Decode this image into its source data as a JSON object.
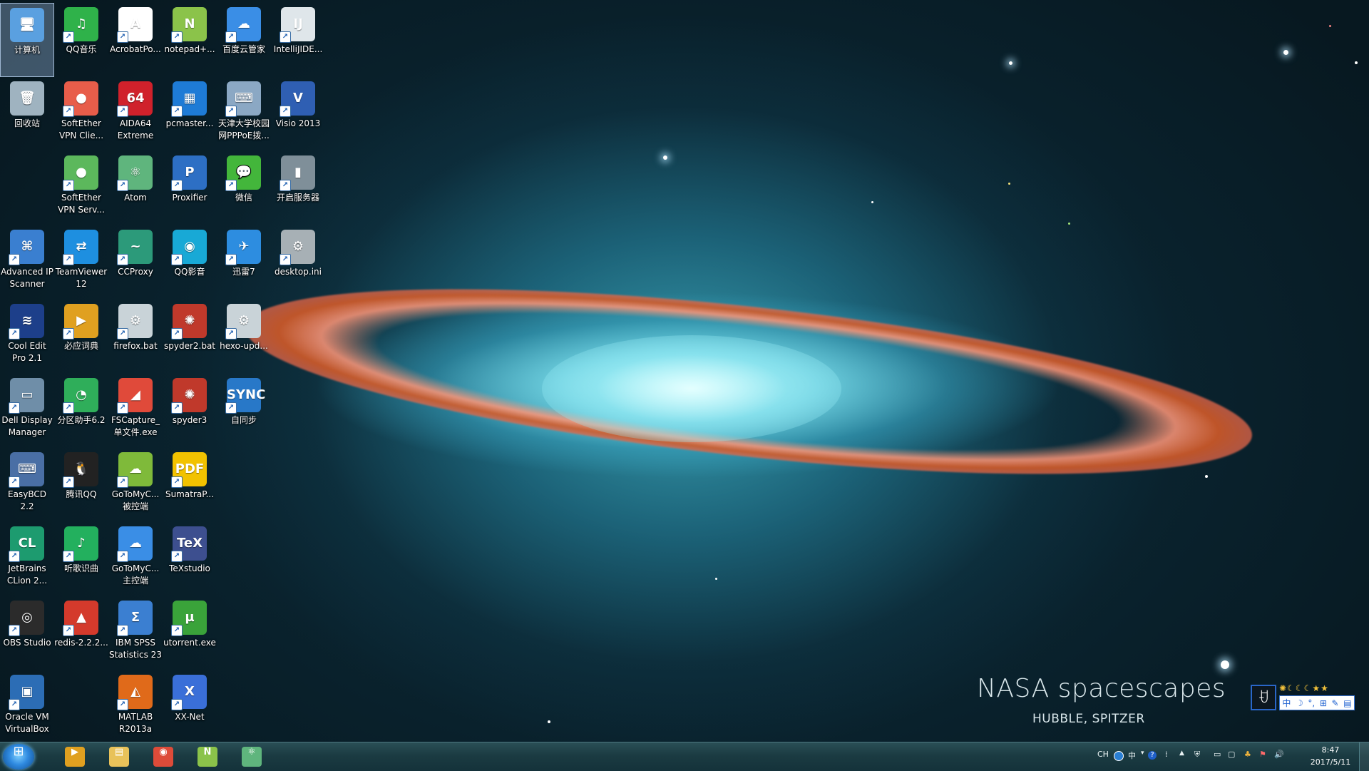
{
  "wallpaper": {
    "title": "NASA spacescapes",
    "subtitle": "HUBBLE, SPITZER"
  },
  "desktop_icons": [
    {
      "label": "计算机",
      "icon": "computer-icon",
      "color": "#5aa0e0",
      "glyph": "🖥"
    },
    {
      "label": "QQ音乐",
      "icon": "qq-music-icon",
      "color": "#2fb24a",
      "glyph": "♫"
    },
    {
      "label": "AcrobatPo...",
      "icon": "acrobat-icon",
      "color": "#ffffff",
      "glyph": "A"
    },
    {
      "label": "notepad+...",
      "icon": "notepad-plus-icon",
      "color": "#8bc34a",
      "glyph": "N"
    },
    {
      "label": "百度云管家",
      "icon": "baidu-cloud-icon",
      "color": "#3a8ee6",
      "glyph": "☁"
    },
    {
      "label": "IntelliJIDE...",
      "icon": "intellij-icon",
      "color": "#dfe6ea",
      "glyph": "IJ"
    },
    {
      "label": "回收站",
      "icon": "recycle-bin-icon",
      "color": "#9fb3c0",
      "glyph": "🗑"
    },
    {
      "label": "SoftEther VPN Clie...",
      "icon": "softether-client-icon",
      "color": "#e85d4a",
      "glyph": "●"
    },
    {
      "label": "AIDA64 Extreme",
      "icon": "aida64-icon",
      "color": "#d0212b",
      "glyph": "64"
    },
    {
      "label": "pcmaster...",
      "icon": "pcmaster-icon",
      "color": "#1e7bd6",
      "glyph": "▦"
    },
    {
      "label": "天津大学校园网PPPoE拨...",
      "icon": "network-dialer-icon",
      "color": "#8ba8c4",
      "glyph": "⌨"
    },
    {
      "label": "Visio 2013",
      "icon": "visio-icon",
      "color": "#2f5fb3",
      "glyph": "V"
    },
    {
      "label": "SoftEther VPN Serv...",
      "icon": "softether-server-icon",
      "color": "#5cb85c",
      "glyph": "●"
    },
    {
      "label": "Atom",
      "icon": "atom-icon",
      "color": "#5fb57d",
      "glyph": "⚛"
    },
    {
      "label": "Proxifier",
      "icon": "proxifier-icon",
      "color": "#2d6fc4",
      "glyph": "P"
    },
    {
      "label": "微信",
      "icon": "wechat-icon",
      "color": "#43b63b",
      "glyph": "💬"
    },
    {
      "label": "开启服务器",
      "icon": "start-server-icon",
      "color": "#7f8f99",
      "glyph": "▮"
    },
    {
      "label": "Advanced IP Scanner",
      "icon": "ip-scanner-icon",
      "color": "#3a7fd0",
      "glyph": "⌘"
    },
    {
      "label": "TeamViewer 12",
      "icon": "teamviewer-icon",
      "color": "#1e8fe0",
      "glyph": "⇄"
    },
    {
      "label": "CCProxy",
      "icon": "ccproxy-icon",
      "color": "#2c9a7a",
      "glyph": "~"
    },
    {
      "label": "QQ影音",
      "icon": "qq-player-icon",
      "color": "#18a9d6",
      "glyph": "◉"
    },
    {
      "label": "迅雷7",
      "icon": "xunlei-icon",
      "color": "#2d8de0",
      "glyph": "✈"
    },
    {
      "label": "desktop.ini",
      "icon": "ini-file-icon",
      "color": "#a7b0b5",
      "glyph": "⚙"
    },
    {
      "label": "Cool Edit Pro 2.1",
      "icon": "cool-edit-icon",
      "color": "#1d3f8a",
      "glyph": "≋"
    },
    {
      "label": "必应词典",
      "icon": "bing-dictionary-icon",
      "color": "#e0a020",
      "glyph": "▶"
    },
    {
      "label": "firefox.bat",
      "icon": "bat-file-icon",
      "color": "#c9d3d8",
      "glyph": "⚙"
    },
    {
      "label": "spyder2.bat",
      "icon": "spyder-icon",
      "color": "#c0392b",
      "glyph": "✺"
    },
    {
      "label": "hexo-upd...",
      "icon": "bat-file-icon",
      "color": "#c9d3d8",
      "glyph": "⚙"
    },
    {
      "label": "Dell Display Manager",
      "icon": "dell-display-icon",
      "color": "#6f8ea8",
      "glyph": "▭"
    },
    {
      "label": "分区助手6.2",
      "icon": "partition-assistant-icon",
      "color": "#2fae5a",
      "glyph": "◔"
    },
    {
      "label": "FSCapture_单文件.exe",
      "icon": "fscapture-icon",
      "color": "#e04a3a",
      "glyph": "◢"
    },
    {
      "label": "spyder3",
      "icon": "spyder-icon",
      "color": "#c0392b",
      "glyph": "✺"
    },
    {
      "label": "自同步",
      "icon": "sync-icon",
      "color": "#2878c8",
      "glyph": "SYNC"
    },
    {
      "label": "EasyBCD 2.2",
      "icon": "easybcd-icon",
      "color": "#4a6fa5",
      "glyph": "⌨"
    },
    {
      "label": "腾讯QQ",
      "icon": "qq-icon",
      "color": "#222222",
      "glyph": "🐧"
    },
    {
      "label": "GoToMyC...被控端",
      "icon": "gotomycloud-icon",
      "color": "#7fba3a",
      "glyph": "☁"
    },
    {
      "label": "SumatraP...",
      "icon": "sumatra-pdf-icon",
      "color": "#f2c200",
      "glyph": "PDF"
    },
    {
      "label": "JetBrains CLion 2...",
      "icon": "clion-icon",
      "color": "#1d9b6f",
      "glyph": "CL"
    },
    {
      "label": "听歌识曲",
      "icon": "music-recognition-icon",
      "color": "#23b05e",
      "glyph": "♪"
    },
    {
      "label": "GoToMyC...主控端",
      "icon": "gotomycloud-icon",
      "color": "#3a8ee6",
      "glyph": "☁"
    },
    {
      "label": "TeXstudio",
      "icon": "texstudio-icon",
      "color": "#3d4f8f",
      "glyph": "TeX"
    },
    {
      "label": "OBS Studio",
      "icon": "obs-icon",
      "color": "#2b2b2b",
      "glyph": "◎"
    },
    {
      "label": "redis-2.2.2...",
      "icon": "redis-icon",
      "color": "#d43a2c",
      "glyph": "▲"
    },
    {
      "label": "IBM SPSS Statistics 23",
      "icon": "spss-icon",
      "color": "#3b7fd1",
      "glyph": "Σ"
    },
    {
      "label": "utorrent.exe",
      "icon": "utorrent-icon",
      "color": "#3aa33a",
      "glyph": "µ"
    },
    {
      "label": "Oracle VM VirtualBox",
      "icon": "virtualbox-icon",
      "color": "#2c6db5",
      "glyph": "▣"
    },
    {
      "label": "MATLAB R2013a",
      "icon": "matlab-icon",
      "color": "#e06a1a",
      "glyph": "◭"
    },
    {
      "label": "XX-Net",
      "icon": "xx-net-icon",
      "color": "#3a6fd8",
      "glyph": "X"
    }
  ],
  "ime": {
    "deco": "✺☾☾☾★★",
    "items": [
      "中",
      "☽",
      "°,",
      "⊞",
      "✎",
      "▤"
    ]
  },
  "taskbar": {
    "apps": [
      {
        "name": "bing-dictionary",
        "color": "#e0a020",
        "glyph": "▶"
      },
      {
        "name": "file-explorer",
        "color": "#e8c25a",
        "glyph": "▤"
      },
      {
        "name": "chrome",
        "color": "#dd4b39",
        "glyph": "◉"
      },
      {
        "name": "notepad-plus",
        "color": "#8bc34a",
        "glyph": "N"
      },
      {
        "name": "atom",
        "color": "#5fb57d",
        "glyph": "⚛"
      }
    ],
    "tray": {
      "lang": "CH",
      "ime_short": "中",
      "time": "8:47",
      "date": "2017/5/11"
    }
  }
}
